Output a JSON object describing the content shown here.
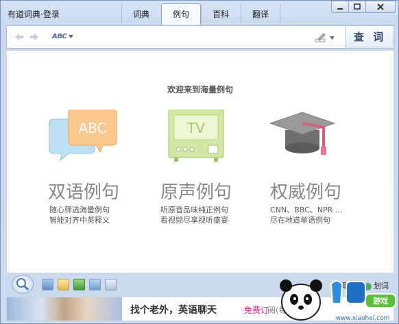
{
  "app": {
    "title": "有道词典",
    "separator": "·",
    "login": "登录"
  },
  "tabs": [
    {
      "label": "词典",
      "active": false
    },
    {
      "label": "例句",
      "active": true
    },
    {
      "label": "百科",
      "active": false
    },
    {
      "label": "翻译",
      "active": false
    }
  ],
  "search": {
    "lang_label": "ABC",
    "value": "",
    "placeholder": "",
    "button_label": "查 词"
  },
  "main": {
    "welcome": "欢迎来到海量例句",
    "features": [
      {
        "name": "双语例句",
        "desc1": "随心筛选海量例句",
        "desc2": "智能对齐中英释义",
        "icon": "abc-speech-bubble-icon",
        "icon_text": "ABC"
      },
      {
        "name": "原声例句",
        "desc1": "听原音品味纯正例句",
        "desc2": "看视频尽享视听盛宴",
        "icon": "tv-icon",
        "icon_text": "TV"
      },
      {
        "name": "权威例句",
        "desc1": "CNN、BBC、NPR ...",
        "desc2": "尽在地道单语例句",
        "icon": "graduation-cap-icon"
      }
    ]
  },
  "toolbar": {
    "icons": [
      "monitor-icon",
      "wordbook-icon",
      "translate-icon",
      "dictionary-icon",
      "mobile-icon"
    ],
    "options": [
      {
        "label": "取词",
        "checked": true
      },
      {
        "label": "划词",
        "checked": true
      }
    ]
  },
  "banner": {
    "headline": "找个老外，英语聊天",
    "free": "免费订",
    "rest": "阅(每日"
  },
  "watermark": {
    "text": "小黑游戏",
    "url": "www.xiaohei.com"
  },
  "colors": {
    "accent": "#344b6d",
    "window_bg": "#d7e4f4",
    "feature_gray": "#888888",
    "banner_pink": "#e0208a"
  }
}
